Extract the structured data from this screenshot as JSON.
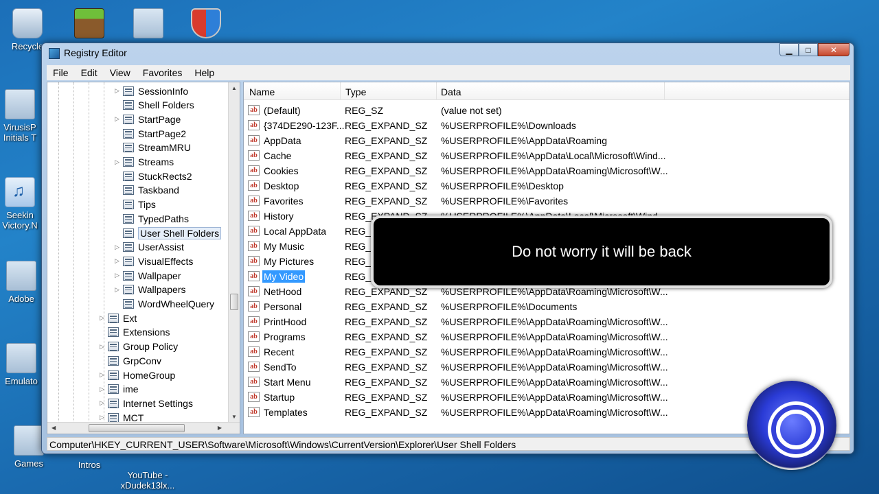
{
  "desktop": {
    "icons": [
      {
        "label": "Recycle",
        "icon": "recycle-bin-icon"
      },
      {
        "label": "",
        "icon": "minecraft-icon"
      },
      {
        "label": "",
        "icon": "folder-icon"
      },
      {
        "label": "",
        "icon": "winrar-shield-icon"
      },
      {
        "label": "VirusisP\nInitials T",
        "icon": "folder-icon"
      },
      {
        "label": "Seekin\nVictory.N",
        "icon": "mp3-icon"
      },
      {
        "label": "Adobe",
        "icon": "folder-icon"
      },
      {
        "label": "Emulato",
        "icon": "folder-icon"
      },
      {
        "label": "Games",
        "icon": "folder-icon"
      },
      {
        "label": "Intros",
        "icon": "folder-icon"
      },
      {
        "label": "YouTube -\nxDudek13lx...",
        "icon": "folder-icon"
      }
    ]
  },
  "window": {
    "title": "Registry Editor",
    "menu": [
      "File",
      "Edit",
      "View",
      "Favorites",
      "Help"
    ],
    "buttons": {
      "minimize": "▁",
      "maximize": "□",
      "close": "✕"
    }
  },
  "tree": {
    "items": [
      {
        "label": "SessionInfo",
        "expandable": true,
        "level": 2
      },
      {
        "label": "Shell Folders",
        "expandable": false,
        "level": 2
      },
      {
        "label": "StartPage",
        "expandable": true,
        "level": 2
      },
      {
        "label": "StartPage2",
        "expandable": false,
        "level": 2
      },
      {
        "label": "StreamMRU",
        "expandable": false,
        "level": 2
      },
      {
        "label": "Streams",
        "expandable": true,
        "level": 2
      },
      {
        "label": "StuckRects2",
        "expandable": false,
        "level": 2
      },
      {
        "label": "Taskband",
        "expandable": false,
        "level": 2
      },
      {
        "label": "Tips",
        "expandable": false,
        "level": 2
      },
      {
        "label": "TypedPaths",
        "expandable": false,
        "level": 2
      },
      {
        "label": "User Shell Folders",
        "expandable": false,
        "level": 2,
        "selected": true
      },
      {
        "label": "UserAssist",
        "expandable": true,
        "level": 2
      },
      {
        "label": "VisualEffects",
        "expandable": true,
        "level": 2
      },
      {
        "label": "Wallpaper",
        "expandable": true,
        "level": 2
      },
      {
        "label": "Wallpapers",
        "expandable": true,
        "level": 2
      },
      {
        "label": "WordWheelQuery",
        "expandable": false,
        "level": 2
      },
      {
        "label": "Ext",
        "expandable": true,
        "level": 1
      },
      {
        "label": "Extensions",
        "expandable": false,
        "level": 1
      },
      {
        "label": "Group Policy",
        "expandable": true,
        "level": 1
      },
      {
        "label": "GrpConv",
        "expandable": false,
        "level": 1
      },
      {
        "label": "HomeGroup",
        "expandable": true,
        "level": 1
      },
      {
        "label": "ime",
        "expandable": true,
        "level": 1
      },
      {
        "label": "Internet Settings",
        "expandable": true,
        "level": 1
      },
      {
        "label": "MCT",
        "expandable": true,
        "level": 1
      }
    ]
  },
  "list": {
    "columns": {
      "name": "Name",
      "type": "Type",
      "data": "Data"
    },
    "rows": [
      {
        "name": "(Default)",
        "type": "REG_SZ",
        "data": "(value not set)"
      },
      {
        "name": "{374DE290-123F...",
        "type": "REG_EXPAND_SZ",
        "data": "%USERPROFILE%\\Downloads"
      },
      {
        "name": "AppData",
        "type": "REG_EXPAND_SZ",
        "data": "%USERPROFILE%\\AppData\\Roaming"
      },
      {
        "name": "Cache",
        "type": "REG_EXPAND_SZ",
        "data": "%USERPROFILE%\\AppData\\Local\\Microsoft\\Wind..."
      },
      {
        "name": "Cookies",
        "type": "REG_EXPAND_SZ",
        "data": "%USERPROFILE%\\AppData\\Roaming\\Microsoft\\W..."
      },
      {
        "name": "Desktop",
        "type": "REG_EXPAND_SZ",
        "data": "%USERPROFILE%\\Desktop"
      },
      {
        "name": "Favorites",
        "type": "REG_EXPAND_SZ",
        "data": "%USERPROFILE%\\Favorites"
      },
      {
        "name": "History",
        "type": "REG_EXPAND_SZ",
        "data": "%USERPROFILE%\\AppData\\Local\\Microsoft\\Wind..."
      },
      {
        "name": "Local AppData",
        "type": "REG_E",
        "data": ""
      },
      {
        "name": "My Music",
        "type": "REG_E",
        "data": ""
      },
      {
        "name": "My Pictures",
        "type": "REG_E",
        "data": ""
      },
      {
        "name": "My Video",
        "type": "REG_E",
        "data": "",
        "selected": true
      },
      {
        "name": "NetHood",
        "type": "REG_EXPAND_SZ",
        "data": "%USERPROFILE%\\AppData\\Roaming\\Microsoft\\W..."
      },
      {
        "name": "Personal",
        "type": "REG_EXPAND_SZ",
        "data": "%USERPROFILE%\\Documents"
      },
      {
        "name": "PrintHood",
        "type": "REG_EXPAND_SZ",
        "data": "%USERPROFILE%\\AppData\\Roaming\\Microsoft\\W..."
      },
      {
        "name": "Programs",
        "type": "REG_EXPAND_SZ",
        "data": "%USERPROFILE%\\AppData\\Roaming\\Microsoft\\W..."
      },
      {
        "name": "Recent",
        "type": "REG_EXPAND_SZ",
        "data": "%USERPROFILE%\\AppData\\Roaming\\Microsoft\\W..."
      },
      {
        "name": "SendTo",
        "type": "REG_EXPAND_SZ",
        "data": "%USERPROFILE%\\AppData\\Roaming\\Microsoft\\W..."
      },
      {
        "name": "Start Menu",
        "type": "REG_EXPAND_SZ",
        "data": "%USERPROFILE%\\AppData\\Roaming\\Microsoft\\W..."
      },
      {
        "name": "Startup",
        "type": "REG_EXPAND_SZ",
        "data": "%USERPROFILE%\\AppData\\Roaming\\Microsoft\\W..."
      },
      {
        "name": "Templates",
        "type": "REG_EXPAND_SZ",
        "data": "%USERPROFILE%\\AppData\\Roaming\\Microsoft\\W..."
      }
    ],
    "value_icon_text": "ab"
  },
  "status": {
    "path": "Computer\\HKEY_CURRENT_USER\\Software\\Microsoft\\Windows\\CurrentVersion\\Explorer\\User Shell Folders"
  },
  "overlay": {
    "caption": "Do not worry it will be back"
  }
}
